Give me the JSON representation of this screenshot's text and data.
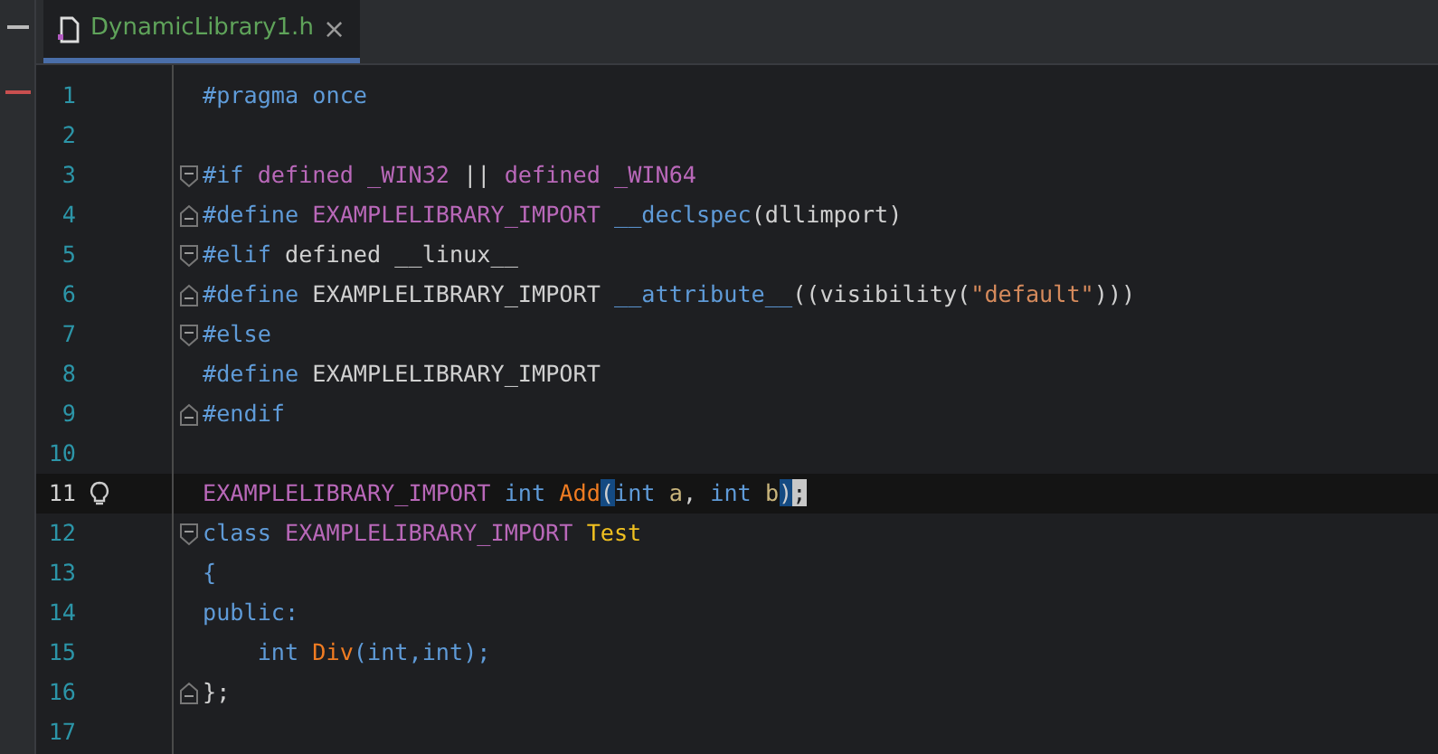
{
  "tab": {
    "label": "DynamicLibrary1.h",
    "selected": true,
    "close": "×"
  },
  "lines": [
    {
      "number": "1",
      "current": false,
      "tokens": [
        {
          "text": "#pragma once",
          "kind": "directive"
        }
      ]
    },
    {
      "number": "2",
      "current": false
    },
    {
      "number": "3",
      "fold_start": true,
      "current": false,
      "tokens": [
        {
          "text": "#if ",
          "kind": "directive"
        },
        {
          "text": "defined _WIN32 ",
          "kind": "macro"
        },
        {
          "text": "|| ",
          "kind": "plain"
        },
        {
          "text": "defined _WIN64",
          "kind": "macro"
        }
      ]
    },
    {
      "number": "4",
      "fold_end": true,
      "current": false,
      "tokens": [
        {
          "text": "#define ",
          "kind": "directive"
        },
        {
          "text": "EXAMPLELIBRARY_IMPORT ",
          "kind": "macro"
        },
        {
          "text": "__declspec",
          "kind": "keyword"
        },
        {
          "text": "(dllimport)",
          "kind": "plain"
        }
      ]
    },
    {
      "number": "5",
      "fold_start": true,
      "current": false,
      "tokens": [
        {
          "text": "#elif ",
          "kind": "directive"
        },
        {
          "text": "defined __linux__",
          "kind": "plain"
        }
      ]
    },
    {
      "number": "6",
      "fold_end": true,
      "current": false,
      "tokens": [
        {
          "text": "#define ",
          "kind": "directive"
        },
        {
          "text": "EXAMPLELIBRARY_IMPORT ",
          "kind": "plain"
        },
        {
          "text": "__attribute__",
          "kind": "keyword"
        },
        {
          "text": "((visibility(",
          "kind": "plain"
        },
        {
          "text": "\"default\"",
          "kind": "string"
        },
        {
          "text": ")))",
          "kind": "plain"
        }
      ]
    },
    {
      "number": "7",
      "fold_start": true,
      "current": false,
      "tokens": [
        {
          "text": "#else",
          "kind": "directive"
        }
      ]
    },
    {
      "number": "8",
      "current": false,
      "tokens": [
        {
          "text": "#define ",
          "kind": "directive"
        },
        {
          "text": "EXAMPLELIBRARY_IMPORT",
          "kind": "plain"
        }
      ]
    },
    {
      "number": "9",
      "fold_end": true,
      "current": false,
      "tokens": [
        {
          "text": "#endif",
          "kind": "directive"
        }
      ]
    },
    {
      "number": "10",
      "current": false
    },
    {
      "number": "11",
      "current": true,
      "tokens": [
        {
          "text": "EXAMPLELIBRARY_IMPORT ",
          "kind": "macro"
        },
        {
          "text": "int ",
          "kind": "keyword"
        },
        {
          "text": "Add",
          "kind": "function"
        },
        {
          "text": "(",
          "kind": "plain",
          "matched": true
        },
        {
          "text": "int ",
          "kind": "keyword"
        },
        {
          "text": "a",
          "kind": "param"
        },
        {
          "text": ", ",
          "kind": "plain"
        },
        {
          "text": "int ",
          "kind": "keyword"
        },
        {
          "text": "b",
          "kind": "param"
        },
        {
          "text": ")",
          "kind": "plain",
          "matched": true
        },
        {
          "text": ";",
          "kind": "plain",
          "at_caret": true
        }
      ]
    },
    {
      "number": "12",
      "fold_start": true,
      "current": false,
      "tokens": [
        {
          "text": "class ",
          "kind": "keyword"
        },
        {
          "text": "EXAMPLELIBRARY_IMPORT ",
          "kind": "macro"
        },
        {
          "text": "Test",
          "kind": "class"
        }
      ]
    },
    {
      "number": "13",
      "current": false,
      "tokens": [
        {
          "text": "{",
          "kind": "keyword"
        }
      ]
    },
    {
      "number": "14",
      "current": false,
      "tokens": [
        {
          "text": "public:",
          "kind": "keyword"
        }
      ]
    },
    {
      "number": "15",
      "current": false,
      "indented": true,
      "tokens": [
        {
          "text": "int ",
          "kind": "keyword"
        },
        {
          "text": "Div",
          "kind": "function"
        },
        {
          "text": "(int,int);",
          "kind": "keyword"
        }
      ]
    },
    {
      "number": "16",
      "fold_end": true,
      "current": false,
      "tokens": [
        {
          "text": "};",
          "kind": "plain"
        }
      ]
    },
    {
      "number": "17",
      "current": false
    }
  ]
}
